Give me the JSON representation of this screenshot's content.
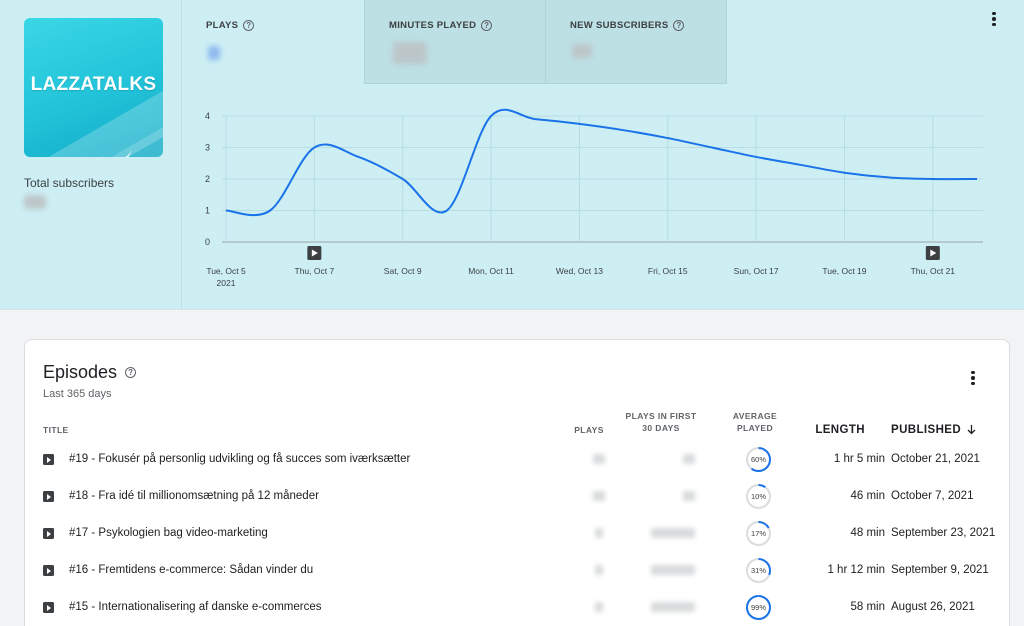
{
  "show": {
    "cover_title": "LAZZATALKS",
    "subscribers_label": "Total subscribers"
  },
  "metrics": [
    {
      "label": "PLAYS"
    },
    {
      "label": "MINUTES PLAYED"
    },
    {
      "label": "NEW SUBSCRIBERS"
    }
  ],
  "icons": {
    "help": "help-circle-icon",
    "more": "more-vert-icon",
    "play": "play-icon",
    "sort": "arrow-down-icon"
  },
  "colors": {
    "line": "#1a73e8",
    "panel": "#cdeff4",
    "ring_bg": "#dadce0"
  },
  "chart_data": {
    "type": "line",
    "x": [
      "Tue, Oct 5\n2021",
      "Wed, Oct 6",
      "Thu, Oct 7",
      "Fri, Oct 8",
      "Sat, Oct 9",
      "Sun, Oct 10",
      "Mon, Oct 11",
      "Tue, Oct 12",
      "Wed, Oct 13",
      "Thu, Oct 14",
      "Fri, Oct 15",
      "Sat, Oct 16",
      "Sun, Oct 17",
      "Mon, Oct 18",
      "Tue, Oct 19",
      "Wed, Oct 20",
      "Thu, Oct 21",
      "Fri, Oct 22"
    ],
    "tick_labels": [
      "Tue, Oct 5",
      "Thu, Oct 7",
      "Sat, Oct 9",
      "Mon, Oct 11",
      "Wed, Oct 13",
      "Fri, Oct 15",
      "Sun, Oct 17",
      "Tue, Oct 19",
      "Thu, Oct 21"
    ],
    "first_tick_year": "2021",
    "values": [
      1,
      1,
      3,
      2.7,
      2,
      1,
      4,
      3.9,
      3.75,
      3.55,
      3.3,
      3.0,
      2.7,
      2.45,
      2.2,
      2.05,
      2.0,
      2.0
    ],
    "yticks": [
      0,
      1,
      2,
      3,
      4
    ],
    "ylim": [
      0,
      4
    ],
    "grid": true,
    "episode_markers": [
      "Thu, Oct 7",
      "Thu, Oct 21"
    ]
  },
  "episodes": {
    "title": "Episodes",
    "subtitle": "Last 365 days",
    "columns": {
      "title": "TITLE",
      "plays": "PLAYS",
      "plays30": "PLAYS IN FIRST 30 DAYS",
      "avg": "AVERAGE PLAYED",
      "length": "LENGTH",
      "published": "PUBLISHED"
    },
    "rows": [
      {
        "title": "#19 - Fokusér på personlig udvikling og få succes som iværksætter",
        "avg_pct": 60,
        "avg_label": "60%",
        "length": "1 hr 5 min",
        "published": "October 21, 2021"
      },
      {
        "title": "#18 - Fra idé til millionomsætning på 12 måneder",
        "avg_pct": 10,
        "avg_label": "10%",
        "length": "46 min",
        "published": "October 7, 2021"
      },
      {
        "title": "#17 - Psykologien bag video-marketing",
        "avg_pct": 17,
        "avg_label": "17%",
        "length": "48 min",
        "published": "September 23, 2021"
      },
      {
        "title": "#16 - Fremtidens e-commerce: Sådan vinder du",
        "avg_pct": 31,
        "avg_label": "31%",
        "length": "1 hr 12 min",
        "published": "September 9, 2021"
      },
      {
        "title": "#15 - Internationalisering af danske e-commerces",
        "avg_pct": 99,
        "avg_label": "99%",
        "length": "58 min",
        "published": "August 26, 2021"
      }
    ]
  }
}
